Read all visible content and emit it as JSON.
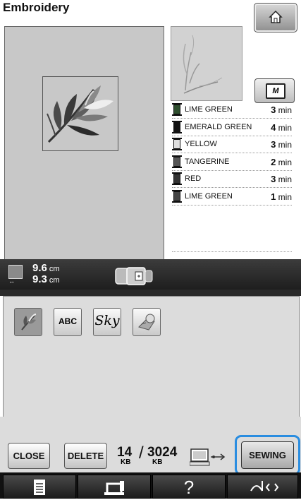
{
  "header": {
    "title": "Embroidery",
    "home_icon": "home-icon"
  },
  "right_panel": {
    "frame_button_icon": "embroidery-frame-icon",
    "frame_button_glyph": "M"
  },
  "threads": [
    {
      "color": "#2f4f2f",
      "name": "LIME GREEN",
      "time": "3",
      "unit": "min"
    },
    {
      "color": "#111111",
      "name": "EMERALD GREEN",
      "time": "4",
      "unit": "min"
    },
    {
      "color": "#e0e0e0",
      "name": "YELLOW",
      "time": "3",
      "unit": "min"
    },
    {
      "color": "#555555",
      "name": "TANGERINE",
      "time": "2",
      "unit": "min"
    },
    {
      "color": "#333333",
      "name": "RED",
      "time": "3",
      "unit": "min"
    },
    {
      "color": "#444444",
      "name": "LIME GREEN",
      "time": "1",
      "unit": "min"
    }
  ],
  "size": {
    "height": "9.6",
    "width": "9.3",
    "unit": "cm"
  },
  "categories": {
    "abc": "ABC",
    "sky": "Sky"
  },
  "footer": {
    "close": "CLOSE",
    "delete": "DELETE",
    "used": "14",
    "slash": "/",
    "total": "3024",
    "unit": "KB",
    "sewing": "SEWING"
  },
  "nav": {
    "help": "?"
  },
  "colors": {
    "highlight": "#2a8de0",
    "preview_bg": "#c8c8c8"
  }
}
